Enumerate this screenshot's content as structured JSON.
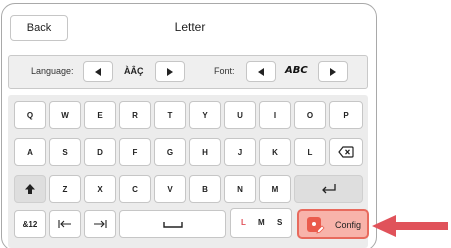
{
  "header": {
    "back_label": "Back",
    "title": "Letter"
  },
  "options": {
    "language_label": "Language:",
    "language_sample": "ÀÂÇ",
    "font_label": "Font:",
    "font_sample": "ABC"
  },
  "keyboard": {
    "row1": [
      "Q",
      "W",
      "E",
      "R",
      "T",
      "Y",
      "U",
      "I",
      "O",
      "P"
    ],
    "row2": [
      "A",
      "S",
      "D",
      "F",
      "G",
      "H",
      "J",
      "K",
      "L"
    ],
    "row3": [
      "Z",
      "X",
      "C",
      "V",
      "B",
      "N",
      "M"
    ],
    "row4": {
      "symbols_label": "&12"
    },
    "size_letters": [
      "L",
      "M",
      "S"
    ],
    "size_active": "L",
    "config_label": "Config"
  },
  "colors": {
    "accent": "#ea5b4c",
    "config_bg": "#f8b3aa",
    "arrow": "#e0525a"
  }
}
